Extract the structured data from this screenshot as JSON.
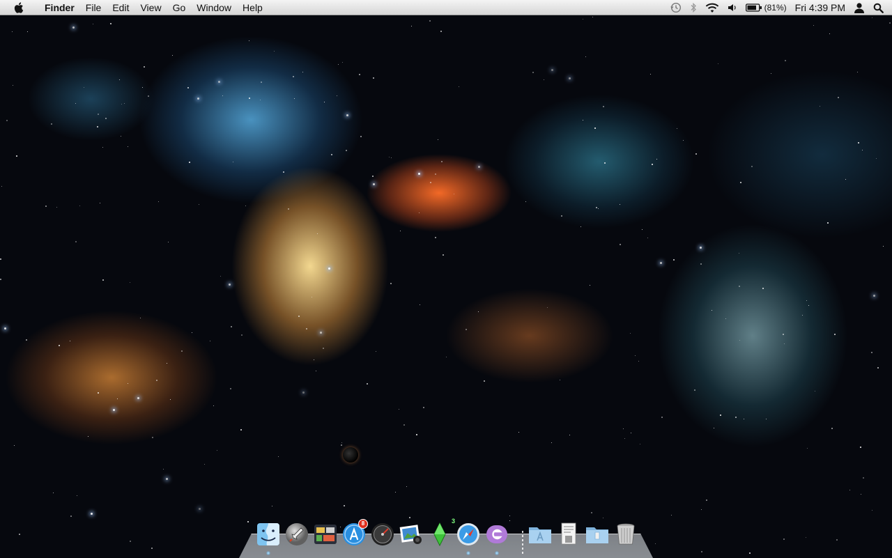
{
  "menubar": {
    "apple_icon": "apple-icon",
    "app_name": "Finder",
    "menus": [
      "File",
      "Edit",
      "View",
      "Go",
      "Window",
      "Help"
    ],
    "status": {
      "time_machine_icon": "time-machine-icon",
      "bluetooth_icon": "bluetooth-icon",
      "wifi_icon": "wifi-icon",
      "volume_icon": "volume-icon",
      "battery_icon": "battery-icon",
      "battery_percent": "(81%)",
      "clock": "Fri 4:39 PM",
      "user_icon": "user-icon",
      "spotlight_icon": "spotlight-search-icon"
    }
  },
  "dock": {
    "apps": [
      {
        "name": "finder-icon"
      },
      {
        "name": "launchpad-icon"
      },
      {
        "name": "mission-control-icon"
      },
      {
        "name": "app-store-icon",
        "badge": "8"
      },
      {
        "name": "dashboard-icon"
      },
      {
        "name": "iphoto-icon"
      },
      {
        "name": "sims-icon",
        "badge": "3"
      },
      {
        "name": "safari-icon"
      },
      {
        "name": "app-icon-purple"
      }
    ],
    "folders": [
      {
        "name": "applications-folder-icon"
      },
      {
        "name": "documents-stack-icon"
      },
      {
        "name": "downloads-folder-icon"
      },
      {
        "name": "trash-icon"
      }
    ]
  },
  "colors": {
    "menubar_top": "#f4f4f4",
    "menubar_bottom": "#d6d6d6",
    "badge_red": "#e0301e"
  }
}
